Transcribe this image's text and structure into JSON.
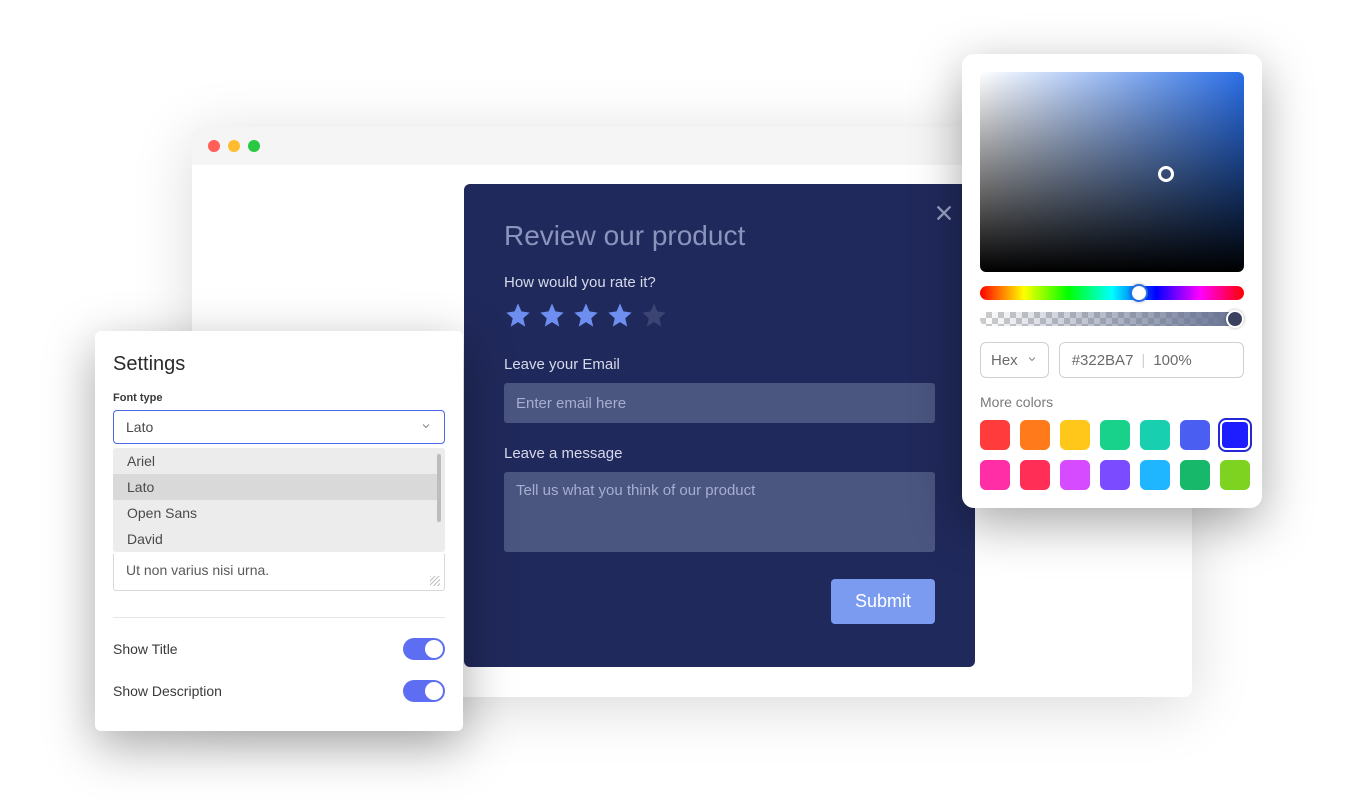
{
  "review": {
    "title": "Review our product",
    "rate_question": "How would you rate it?",
    "rating": 4,
    "email_label": "Leave your Email",
    "email_placeholder": "Enter email here",
    "message_label": "Leave a message",
    "message_placeholder": "Tell us what you think of our product",
    "submit_label": "Submit"
  },
  "settings": {
    "title": "Settings",
    "font_type_label": "Font type",
    "selected_font": "Lato",
    "font_options": [
      "Ariel",
      "Lato",
      "Open Sans",
      "David"
    ],
    "extra_text": "Ut non varius nisi urna.",
    "show_title_label": "Show Title",
    "show_title_on": true,
    "show_description_label": "Show Description",
    "show_description_on": true
  },
  "picker": {
    "format_label": "Hex",
    "hex_value": "#322BA7",
    "opacity_value": "100%",
    "more_colors_label": "More colors",
    "swatches": [
      "#ff3b3b",
      "#ff7a1a",
      "#ffc71a",
      "#18d18a",
      "#18cfb0",
      "#4a5ef2",
      "#1d1dff",
      "#ff2ea6",
      "#ff2e57",
      "#d64bff",
      "#7a4bff",
      "#1fb6ff",
      "#18b86b",
      "#7ed321"
    ],
    "selected_swatch_index": 6
  }
}
